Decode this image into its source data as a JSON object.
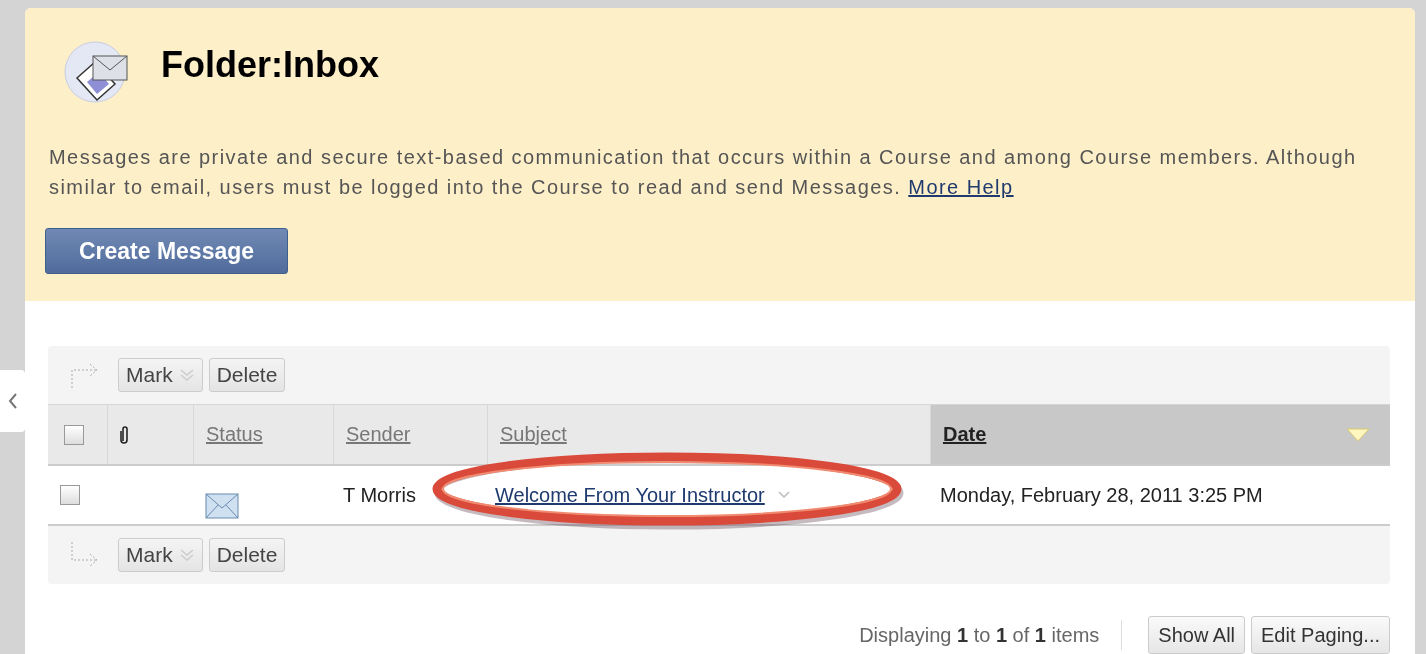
{
  "header": {
    "title": "Folder:Inbox",
    "description": "Messages are private and secure text-based communication that occurs within a Course and among Course members. Although similar to email, users must be logged into the Course to read and send Messages.",
    "help_link": "More Help",
    "create_button": "Create Message"
  },
  "toolbars": [
    {
      "kind": "top",
      "buttons": [
        "Mark",
        "Delete"
      ]
    },
    {
      "kind": "bottom",
      "buttons": [
        "Mark",
        "Delete"
      ]
    }
  ],
  "table": {
    "columns": [
      {
        "kind": "checkbox",
        "checked": false
      },
      {
        "kind": "attachment"
      },
      {
        "kind": "text",
        "label": "Status",
        "sorted": false
      },
      {
        "kind": "text",
        "label": "Sender",
        "sorted": false
      },
      {
        "kind": "text",
        "label": "Subject",
        "sorted": false
      },
      {
        "kind": "text",
        "label": "Date",
        "sorted": true
      }
    ],
    "rows": [
      {
        "checked": false,
        "read": false,
        "sender": "T Morris",
        "subject": "Welcome From Your Instructor",
        "highlighted": true,
        "date": "Monday, February 28, 2011 3:25 PM"
      }
    ]
  },
  "paging": {
    "summary": "Displaying **1** to **1** of **1** items",
    "buttons": [
      "Show All",
      "Edit Paging..."
    ]
  }
}
